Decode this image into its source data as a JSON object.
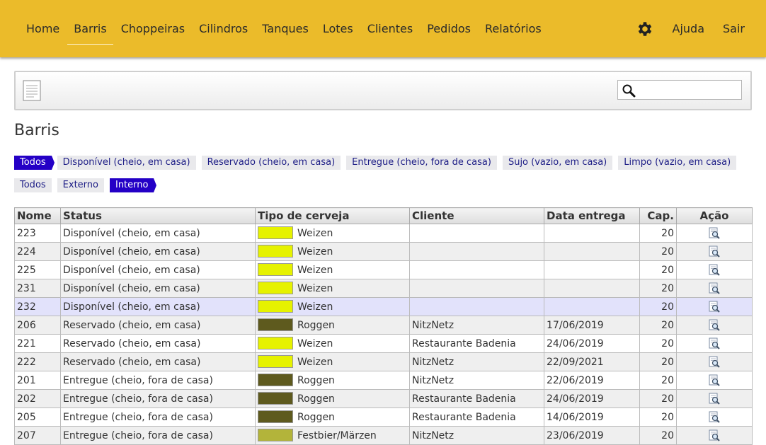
{
  "nav": {
    "items": [
      "Home",
      "Barris",
      "Choppeiras",
      "Cilindros",
      "Tanques",
      "Lotes",
      "Clientes",
      "Pedidos",
      "Relatórios"
    ],
    "active_index": 1,
    "right": {
      "settings_icon": "gear-icon",
      "help": "Ajuda",
      "logout": "Sair"
    }
  },
  "toolbar": {
    "doc_icon": "document-icon",
    "search_icon": "search-icon",
    "search_value": ""
  },
  "page": {
    "title": "Barris"
  },
  "filters": {
    "status": [
      "Todos",
      "Disponível (cheio, em casa)",
      "Reservado (cheio, em casa)",
      "Entregue (cheio, fora de casa)",
      "Sujo (vazio, em casa)",
      "Limpo (vazio, em casa)"
    ],
    "status_active": 0,
    "location": [
      "Todos",
      "Externo",
      "Interno"
    ],
    "location_active": 2
  },
  "table": {
    "headers": [
      "Nome",
      "Status",
      "Tipo de cerveja",
      "Cliente",
      "Data entrega",
      "Cap.",
      "Ação"
    ],
    "rows": [
      {
        "nome": "223",
        "status": "Disponível (cheio, em casa)",
        "color": "#e6f200",
        "beer": "Weizen",
        "client": "",
        "date": "",
        "cap": "20"
      },
      {
        "nome": "224",
        "status": "Disponível (cheio, em casa)",
        "color": "#e6f200",
        "beer": "Weizen",
        "client": "",
        "date": "",
        "cap": "20"
      },
      {
        "nome": "225",
        "status": "Disponível (cheio, em casa)",
        "color": "#e6f200",
        "beer": "Weizen",
        "client": "",
        "date": "",
        "cap": "20"
      },
      {
        "nome": "231",
        "status": "Disponível (cheio, em casa)",
        "color": "#e6f200",
        "beer": "Weizen",
        "client": "",
        "date": "",
        "cap": "20"
      },
      {
        "nome": "232",
        "status": "Disponível (cheio, em casa)",
        "color": "#e6f200",
        "beer": "Weizen",
        "client": "",
        "date": "",
        "cap": "20"
      },
      {
        "nome": "206",
        "status": "Reservado (cheio, em casa)",
        "color": "#5e5a1e",
        "beer": "Roggen",
        "client": "NitzNetz",
        "date": "17/06/2019",
        "cap": "20"
      },
      {
        "nome": "221",
        "status": "Reservado (cheio, em casa)",
        "color": "#e6f200",
        "beer": "Weizen",
        "client": "Restaurante Badenia",
        "date": "24/06/2019",
        "cap": "20"
      },
      {
        "nome": "222",
        "status": "Reservado (cheio, em casa)",
        "color": "#e6f200",
        "beer": "Weizen",
        "client": "NitzNetz",
        "date": "22/09/2021",
        "cap": "20"
      },
      {
        "nome": "201",
        "status": "Entregue (cheio, fora de casa)",
        "color": "#5e5a1e",
        "beer": "Roggen",
        "client": "NitzNetz",
        "date": "22/06/2019",
        "cap": "20"
      },
      {
        "nome": "202",
        "status": "Entregue (cheio, fora de casa)",
        "color": "#5e5a1e",
        "beer": "Roggen",
        "client": "Restaurante Badenia",
        "date": "24/06/2019",
        "cap": "20"
      },
      {
        "nome": "205",
        "status": "Entregue (cheio, fora de casa)",
        "color": "#5e5a1e",
        "beer": "Roggen",
        "client": "Restaurante Badenia",
        "date": "14/06/2019",
        "cap": "20"
      },
      {
        "nome": "207",
        "status": "Entregue (cheio, fora de casa)",
        "color": "#b3b43a",
        "beer": "Festbier/Märzen",
        "client": "NitzNetz",
        "date": "23/06/2019",
        "cap": "20"
      }
    ],
    "highlight_index": 4,
    "action_icon": "view-details-icon"
  }
}
